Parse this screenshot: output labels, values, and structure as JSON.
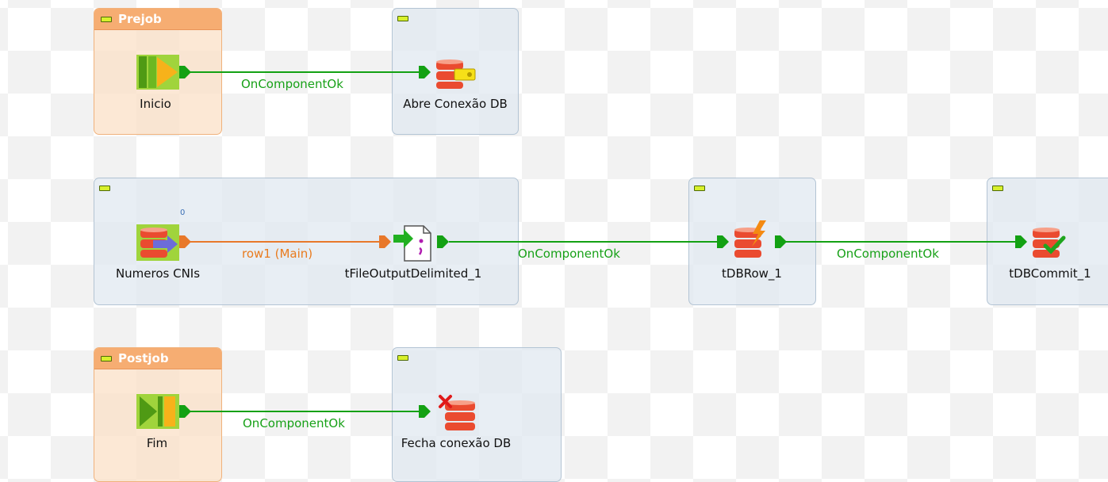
{
  "subjobs": {
    "prejob": {
      "title": "Prejob"
    },
    "postjob": {
      "title": "Postjob"
    }
  },
  "components": {
    "inicio": {
      "label": "Inicio",
      "icon": "prejob-start-icon"
    },
    "abre": {
      "label": "Abre Conexão DB",
      "icon": "db-connection-key-icon"
    },
    "numeros": {
      "label": "Numeros CNIs",
      "icon": "db-input-icon",
      "badge": "0"
    },
    "fileout": {
      "label": "tFileOutputDelimited_1",
      "icon": "file-output-icon"
    },
    "dbrow": {
      "label": "tDBRow_1",
      "icon": "db-row-lightning-icon"
    },
    "commit": {
      "label": "tDBCommit_1",
      "icon": "db-commit-check-icon"
    },
    "fim": {
      "label": "Fim",
      "icon": "postjob-end-icon"
    },
    "fecha": {
      "label": "Fecha conexão DB",
      "icon": "db-close-x-icon"
    }
  },
  "links": {
    "l1": "OnComponentOk",
    "l2": "row1 (Main)",
    "l3": "OnComponentOk",
    "l4": "OnComponentOk",
    "l5": "OnComponentOk"
  },
  "colors": {
    "trigger_link": "#13a113",
    "main_link": "#e8782a",
    "subjob_blue": "#dfe8f0",
    "subjob_orange": "#fbe2c9",
    "db_red": "#ea4b30",
    "collapse_button": "#d8f02c"
  }
}
